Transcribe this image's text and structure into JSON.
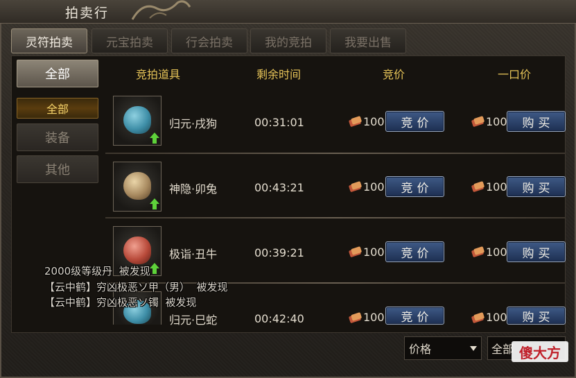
{
  "window": {
    "title": "拍卖行"
  },
  "tabs": [
    {
      "label": "灵符拍卖",
      "active": true
    },
    {
      "label": "元宝拍卖",
      "active": false
    },
    {
      "label": "行会拍卖",
      "active": false
    },
    {
      "label": "我的竞拍",
      "active": false
    },
    {
      "label": "我要出售",
      "active": false
    }
  ],
  "sidebar": {
    "header": "全部",
    "items": [
      {
        "label": "全部",
        "selected": true
      },
      {
        "label": "装备",
        "selected": false
      },
      {
        "label": "其他",
        "selected": false
      }
    ]
  },
  "columns": {
    "item": "竞拍道具",
    "time": "剩余时间",
    "bid": "竞价",
    "buyout": "一口价"
  },
  "rows": [
    {
      "name": "归元·戌狗",
      "time": "00:31:01",
      "bid_price": "100",
      "buyout_price": "100",
      "bid_label": "竞价",
      "buy_label": "购买",
      "icon": "dog-pet-icon",
      "color": "#3f8fa8"
    },
    {
      "name": "神隐·卯兔",
      "time": "00:43:21",
      "bid_price": "100",
      "buyout_price": "100",
      "bid_label": "竞价",
      "buy_label": "购买",
      "icon": "rabbit-pet-icon",
      "color": "#a88a60"
    },
    {
      "name": "极诣·丑牛",
      "time": "00:39:21",
      "bid_price": "100",
      "buyout_price": "100",
      "bid_label": "竞价",
      "buy_label": "购买",
      "icon": "ox-pet-icon",
      "color": "#b84a3a"
    },
    {
      "name": "归元·巳蛇",
      "time": "00:42:40",
      "bid_price": "100",
      "buyout_price": "100",
      "bid_label": "竞价",
      "buy_label": "购买",
      "icon": "snake-pet-icon",
      "color": "#3f8fa8"
    }
  ],
  "chat": [
    "2000级等级丹  被发现",
    "【云中鹤】穷凶极恶ソ甲（男）  被发现",
    "【云中鹤】穷凶极恶ソ镯  被发现"
  ],
  "footer": {
    "sort_value": "价格",
    "filter_value": "全部"
  },
  "watermark": "傻大方",
  "colors": {
    "accent_gold": "#e7c458",
    "button_blue": "#2b4370"
  }
}
